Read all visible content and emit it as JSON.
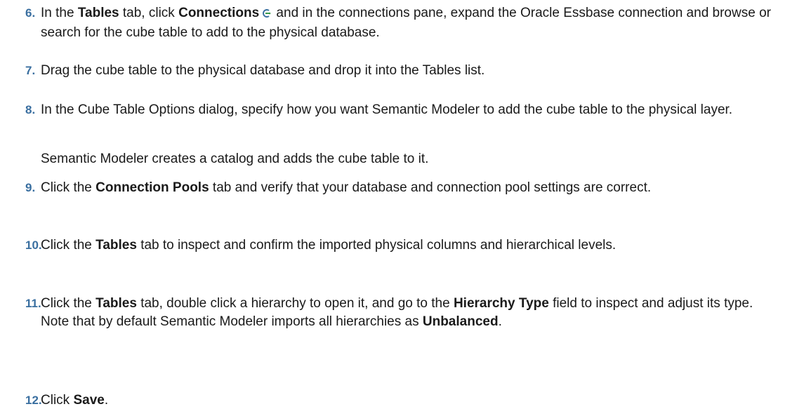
{
  "steps": [
    {
      "number": "6.",
      "parts": [
        "In the ",
        "Tables",
        " tab, click ",
        "Connections",
        " and in the connections pane, expand the Oracle Essbase connection and browse or search for the cube table to add to the physical database."
      ]
    },
    {
      "number": "7.",
      "text": "Drag the cube table to the physical database and drop it into the Tables list."
    },
    {
      "number": "8.",
      "text": "In the Cube Table Options dialog, specify how you want Semantic Modeler to add the cube table to the physical layer.",
      "note": "Semantic Modeler creates a catalog and adds the cube table to it."
    },
    {
      "number": "9.",
      "parts": [
        "Click the ",
        "Connection Pools",
        " tab and verify that your database and connection pool settings are correct."
      ]
    },
    {
      "number": "10.",
      "parts": [
        "Click the ",
        "Tables",
        " tab to inspect and confirm the imported physical columns and hierarchical levels."
      ]
    },
    {
      "number": "11.",
      "parts": [
        "Click the ",
        "Tables",
        " tab, double click a hierarchy to open it, and go to the ",
        "Hierarchy Type",
        " field to inspect and adjust its type. Note that by default Semantic Modeler imports all hierarchies as ",
        "Unbalanced",
        "."
      ]
    },
    {
      "number": "12.",
      "parts": [
        "Click ",
        "Save",
        "."
      ]
    }
  ],
  "icons": {
    "connections": "connections-icon"
  },
  "colors": {
    "step_number": "#3a6fa0",
    "text": "#1a1a1a"
  }
}
